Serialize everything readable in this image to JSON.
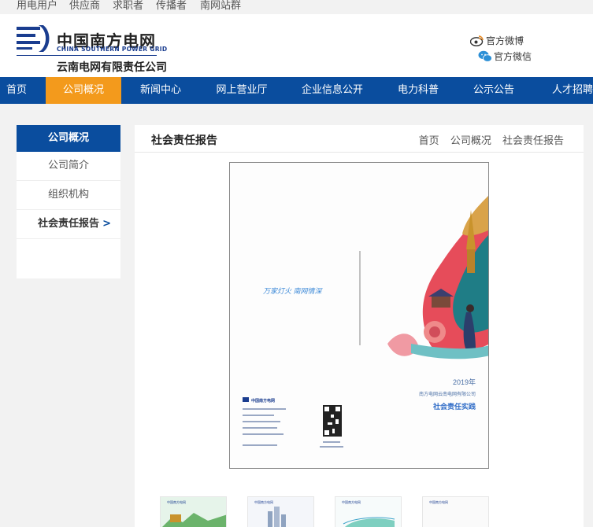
{
  "topbar": {
    "links": [
      "用电用户",
      "供应商",
      "求职者",
      "传播者",
      "南网站群"
    ]
  },
  "header": {
    "logo_cn": "中国南方电网",
    "logo_en": "CHINA SOUTHERN POWER GRID",
    "company": "云南电网有限责任公司",
    "weibo": "官方微博",
    "wechat": "官方微信"
  },
  "nav": {
    "items": [
      "首页",
      "公司概况",
      "新闻中心",
      "网上营业厅",
      "企业信息公开",
      "电力科普",
      "公示公告",
      "人才招聘"
    ],
    "active": "公司概况"
  },
  "sidebar": {
    "title": "公司概况",
    "items": [
      "公司简介",
      "组织机构",
      "社会责任报告"
    ],
    "active_arrow": ">"
  },
  "main": {
    "title": "社会责任报告",
    "breadcrumb": [
      "首页",
      "公司概况",
      "社会责任报告"
    ]
  },
  "report_cover": {
    "slogan": "万家灯火 南网情深",
    "year": "2019年",
    "company": "南方电网云南电网有限公司",
    "subtitle": "社会责任实践",
    "back_logo": "中国南方电网"
  },
  "thumbnails": [
    "中国南方电网",
    "中国南方电网",
    "中国南方电网",
    "中国南方电网"
  ],
  "colors": {
    "nav_blue": "#0a4d9e",
    "active_orange": "#f39a1c",
    "logo_blue": "#1a3d8f"
  }
}
